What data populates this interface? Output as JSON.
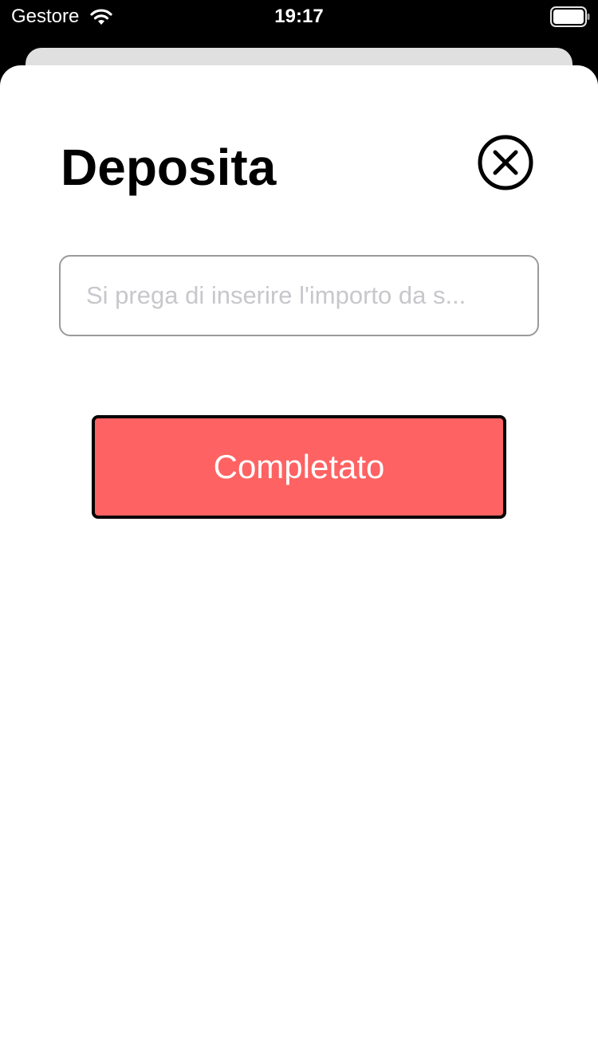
{
  "status_bar": {
    "carrier": "Gestore",
    "time": "19:17",
    "wifi_icon": "wifi-icon",
    "battery_icon": "battery-full-icon",
    "battery_level": 1.0
  },
  "sheet": {
    "title": "Deposita",
    "close_icon": "circle-x-icon",
    "amount_input": {
      "value": "",
      "placeholder": "Si prega di inserire l'importo da s..."
    },
    "complete_button": {
      "label": "Completato",
      "color": "#ff6262"
    }
  }
}
